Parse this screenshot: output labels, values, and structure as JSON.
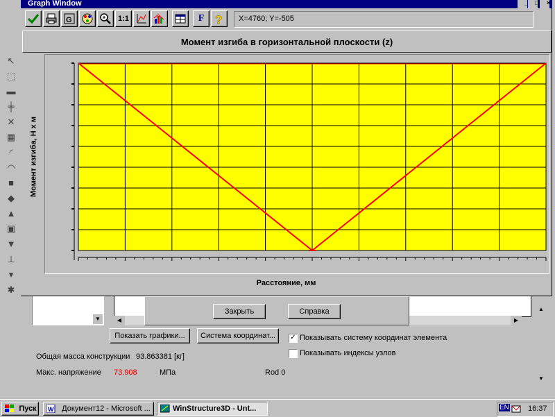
{
  "window": {
    "title": "Graph Window",
    "minimize": "_",
    "maximize": "□",
    "close": "×"
  },
  "toolbar": {
    "coords": "X=4760; Y=-505",
    "buttons": [
      "check-icon",
      "print-icon",
      "copy-icon",
      "palette-icon",
      "zoom-icon",
      "1:1",
      "axes-icon",
      "bar-chart-icon",
      "grid-icon",
      "F",
      "help-icon"
    ]
  },
  "chart_data": {
    "type": "line",
    "title": "Момент изгиба в горизонтальной плоскости (z)",
    "xlabel": "Расстояние, мм",
    "ylabel": "Момент изгиба, Н х м",
    "x": [
      0,
      0.5,
      1
    ],
    "values": [
      0,
      -1,
      0
    ],
    "xlim": [
      0,
      1
    ],
    "ylim": [
      -1,
      0
    ],
    "grid": true,
    "background": "#ffff00",
    "line_color": "#ff0000"
  },
  "dialog": {
    "close_label": "Закрыть",
    "help_label": "Справка"
  },
  "panel": {
    "show_graphs": "Показать графики...",
    "coord_system": "Система координат...",
    "show_coord_system": "Показывать систему координат элемента",
    "show_node_indices": "Показывать индексы узлов",
    "total_mass_label": "Общая масса конструкции",
    "total_mass_value": "93.863381 [кг]",
    "max_stress_label": "Макс. напряжение",
    "max_stress_value": "73.908",
    "max_stress_unit": "МПа",
    "rod_label": "Rod 0"
  },
  "taskbar": {
    "start": "Пуск",
    "tasks": [
      "Документ12 - Microsoft ...",
      "WinStructure3D - Unt..."
    ],
    "lang": "EN",
    "time": "16:37"
  }
}
